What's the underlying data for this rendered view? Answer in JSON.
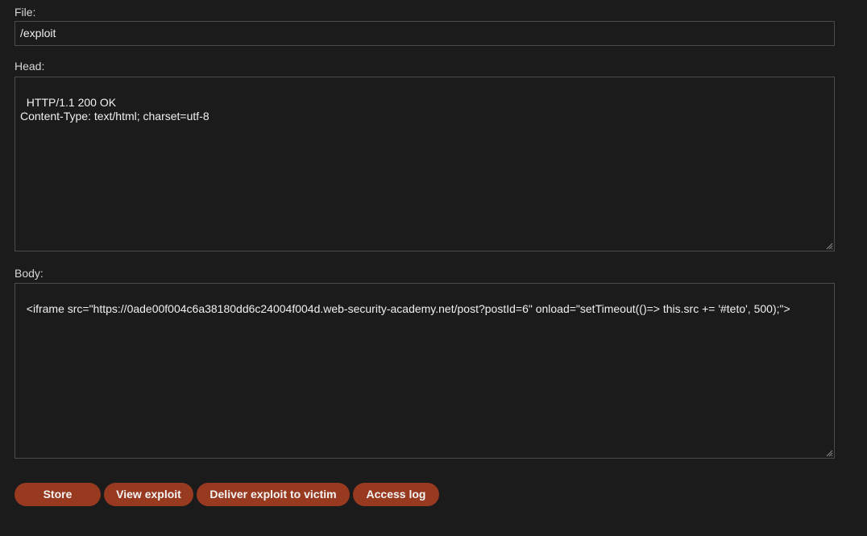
{
  "form": {
    "file_label": "File:",
    "file_value": "/exploit",
    "head_label": "Head:",
    "head_value": "HTTP/1.1 200 OK\nContent-Type: text/html; charset=utf-8",
    "body_label": "Body:",
    "body_value": "<iframe src=\"https://0ade00f004c6a38180dd6c24004f004d.web-security-academy.net/post?postId=6\" onload=\"setTimeout(()=> this.src += '#teto', 500);\">"
  },
  "buttons": {
    "store": "Store",
    "view": "View exploit",
    "deliver": "Deliver exploit to victim",
    "log": "Access log"
  },
  "colors": {
    "background": "#1b1b1b",
    "button": "#973a20",
    "border": "#4a4a4a"
  }
}
